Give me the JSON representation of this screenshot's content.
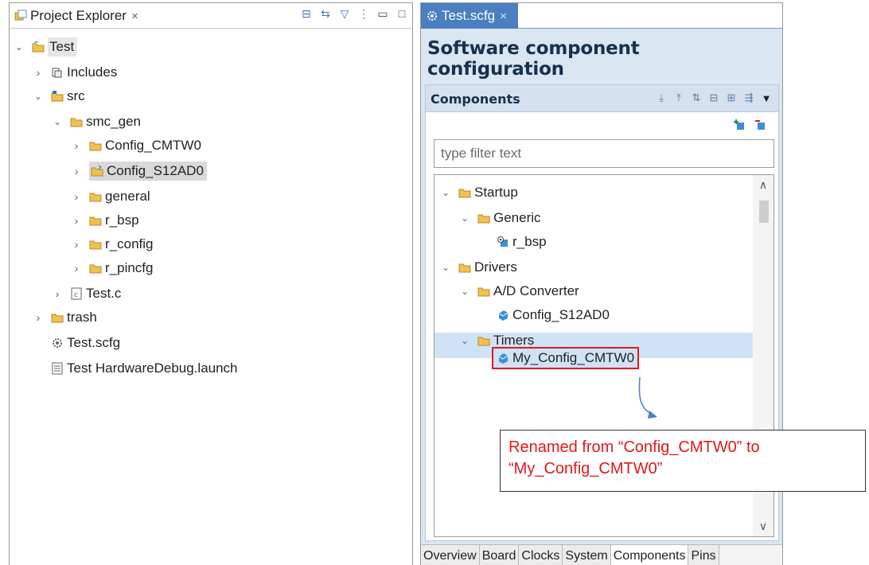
{
  "project_explorer": {
    "tab_label": "Project Explorer",
    "close_glyph": "×",
    "toolbar_icons": [
      "collapse-all-icon",
      "link-with-editor-icon",
      "filter-icon",
      "view-menu-icon",
      "minimize-icon",
      "maximize-icon"
    ],
    "tree": [
      {
        "label": "Test",
        "level": 0,
        "expanded": true,
        "icon": "project-icon"
      },
      {
        "label": "Includes",
        "level": 1,
        "expanded": false,
        "icon": "includes-icon"
      },
      {
        "label": "src",
        "level": 1,
        "expanded": true,
        "icon": "source-folder-icon"
      },
      {
        "label": "smc_gen",
        "level": 2,
        "expanded": true,
        "icon": "folder-icon"
      },
      {
        "label": "Config_CMTW0",
        "level": 3,
        "expanded": false,
        "icon": "folder-icon"
      },
      {
        "label": "Config_S12AD0",
        "level": 3,
        "expanded": false,
        "icon": "linked-folder-icon",
        "selected": true
      },
      {
        "label": "general",
        "level": 3,
        "expanded": false,
        "icon": "folder-icon"
      },
      {
        "label": "r_bsp",
        "level": 3,
        "expanded": false,
        "icon": "folder-icon"
      },
      {
        "label": "r_config",
        "level": 3,
        "expanded": false,
        "icon": "folder-icon"
      },
      {
        "label": "r_pincfg",
        "level": 3,
        "expanded": false,
        "icon": "folder-icon"
      },
      {
        "label": "Test.c",
        "level": 2,
        "expanded": false,
        "icon": "c-file-icon"
      },
      {
        "label": "trash",
        "level": 1,
        "expanded": false,
        "icon": "folder-icon"
      },
      {
        "label": "Test.scfg",
        "level": 1,
        "icon": "gear-file-icon"
      },
      {
        "label": "Test HardwareDebug.launch",
        "level": 1,
        "icon": "launch-file-icon"
      }
    ]
  },
  "editor": {
    "tab_label": "Test.scfg",
    "close_glyph": "×",
    "title": "Software component configuration",
    "section_title": "Components",
    "filter_placeholder": "type filter text",
    "tree": [
      {
        "label": "Startup",
        "level": 0,
        "expanded": true,
        "icon": "folder-icon"
      },
      {
        "label": "Generic",
        "level": 1,
        "expanded": true,
        "icon": "folder-icon"
      },
      {
        "label": "r_bsp",
        "level": 2,
        "icon": "component-bsp-icon"
      },
      {
        "label": "Drivers",
        "level": 0,
        "expanded": true,
        "icon": "folder-icon"
      },
      {
        "label": "A/D Converter",
        "level": 1,
        "expanded": true,
        "icon": "folder-icon"
      },
      {
        "label": "Config_S12AD0",
        "level": 2,
        "icon": "component-icon"
      },
      {
        "label": "Timers",
        "level": 1,
        "expanded": true,
        "icon": "folder-icon"
      },
      {
        "label": "My_Config_CMTW0",
        "level": 2,
        "icon": "component-icon",
        "selected": true,
        "highlighted": true
      }
    ],
    "bottom_tabs": [
      "Overview",
      "Board",
      "Clocks",
      "System",
      "Components",
      "Pins"
    ],
    "active_bottom_tab": "Components"
  },
  "annotation": {
    "line1": "Renamed from “Config_CMTW0” to",
    "line2": "“My_Config_CMTW0”",
    "color": "#e0181c"
  },
  "colors": {
    "editor_tab_bg": "#4a7fc1",
    "editor_bg": "#dbe6f3",
    "selection": "#cfe3f7",
    "highlight_border": "#e0181c",
    "folder_fill": "#f2c14e"
  }
}
